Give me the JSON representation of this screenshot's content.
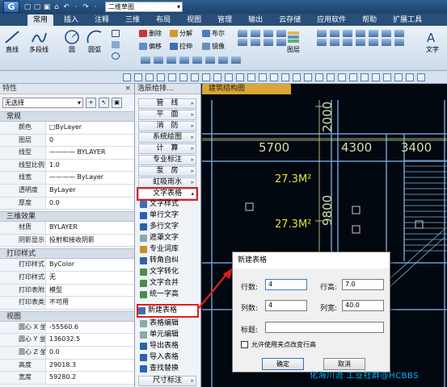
{
  "titlebar": {
    "logo": "G",
    "quick_access": [
      "▢",
      "▢",
      "▣",
      "⌂",
      "↶",
      "·",
      "↷",
      "·"
    ],
    "workspace": "二维草图"
  },
  "ribbon": {
    "tabs": [
      "常用",
      "插入",
      "注释",
      "三维",
      "布局",
      "视图",
      "管理",
      "输出",
      "云存储",
      "应用软件",
      "帮助",
      "扩展工具"
    ],
    "active_tab": "常用",
    "draw": [
      "直线",
      "多段线",
      "圆",
      "圆弧"
    ],
    "modify": [
      "删除",
      "分解",
      "布尔",
      "偏移",
      "拉伸",
      "镜像"
    ],
    "layer_label": "图层",
    "text_label": "文字",
    "colors": {
      "accent": "#2a63b3",
      "active_tab_bg": "#dfe8f3"
    }
  },
  "properties": {
    "title": "特性",
    "close": "×",
    "selection": "无选择",
    "sections": [
      {
        "name": "常规",
        "rows": [
          {
            "key": "颜色",
            "value": "□ByLayer"
          },
          {
            "key": "图层",
            "value": "0"
          },
          {
            "key": "线型",
            "value": "———— BYLAYER"
          },
          {
            "key": "线型比例",
            "value": "1.0"
          },
          {
            "key": "线宽",
            "value": "———— ByLayer"
          },
          {
            "key": "透明度",
            "value": "ByLayer"
          },
          {
            "key": "厚度",
            "value": "0.0"
          }
        ]
      },
      {
        "name": "三维效果",
        "rows": [
          {
            "key": "材质",
            "value": "BYLAYER"
          },
          {
            "key": "阴影显示",
            "value": "投射和接收阴影"
          }
        ]
      },
      {
        "name": "打印样式",
        "rows": [
          {
            "key": "打印样式",
            "value": "ByColor"
          },
          {
            "key": "打印样式表",
            "value": "无"
          },
          {
            "key": "打印表附着到",
            "value": "模型"
          },
          {
            "key": "打印表类型",
            "value": "不可用"
          }
        ]
      },
      {
        "name": "视图",
        "rows": [
          {
            "key": "圆心 X 坐标",
            "value": "-55560.6"
          },
          {
            "key": "圆心 Y 坐标",
            "value": "136032.5"
          },
          {
            "key": "圆心 Z 坐标",
            "value": "0.0"
          },
          {
            "key": "高度",
            "value": "29018.3"
          },
          {
            "key": "宽度",
            "value": "59280.2"
          }
        ]
      }
    ]
  },
  "palette": {
    "title": "浩辰给排...",
    "categories": [
      "管　线",
      "平　面",
      "消　防",
      "系统绘图",
      "计　算",
      "专业标注",
      "泵　房",
      "虹吸雨水"
    ],
    "open_category": "文字表格",
    "items": [
      "文字样式",
      "单行文字",
      "多行文字",
      "遮罩文字",
      "专业词库",
      "转角自纠",
      "文字转化",
      "文字合并",
      "统一字高",
      "新建表格",
      "表格编辑",
      "单元编辑",
      "导出表格",
      "导入表格",
      "查找替换",
      "尺寸标注"
    ]
  },
  "drawing": {
    "tab_label": "建筑结构图",
    "dims": [
      "5700",
      "4300",
      "3400",
      "2000",
      "9800"
    ],
    "areas": [
      "27.3M²",
      "27.3M²"
    ],
    "colors": {
      "background": "#02080f",
      "lines": "#6a9ccf",
      "dims": "#d6dfa8",
      "text": "#e2e23a"
    }
  },
  "dialog": {
    "title": "新建表格",
    "rows_label": "行数:",
    "rows_value": "4",
    "row_height_label": "行高:",
    "row_height_value": "7.0",
    "cols_label": "列数:",
    "cols_value": "4",
    "col_width_label": "列宽:",
    "col_width_value": "40.0",
    "caption_label": "标题:",
    "caption_value": "",
    "checkbox_label": "允许使用夹点改变行高",
    "ok": "确定",
    "cancel": "取消"
  },
  "watermark": "化海川流 工业社群@HCBBS"
}
